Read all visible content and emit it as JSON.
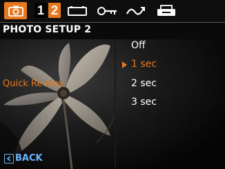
{
  "tabs": {
    "camera_icon": "camera-icon",
    "page_1": "1",
    "page_2": "2",
    "icons": [
      "card-icon",
      "key-icon",
      "wave-icon",
      "printer-icon"
    ]
  },
  "header": {
    "title": "PHOTO SETUP 2"
  },
  "setting": {
    "label": "Quick Review"
  },
  "options": [
    {
      "label": "Off"
    },
    {
      "label": "1 sec",
      "selected": true
    },
    {
      "label": "2 sec"
    },
    {
      "label": "3 sec"
    }
  ],
  "back": {
    "label": "BACK"
  },
  "colors": {
    "accent": "#e8781e",
    "back": "#6ab6ff"
  }
}
